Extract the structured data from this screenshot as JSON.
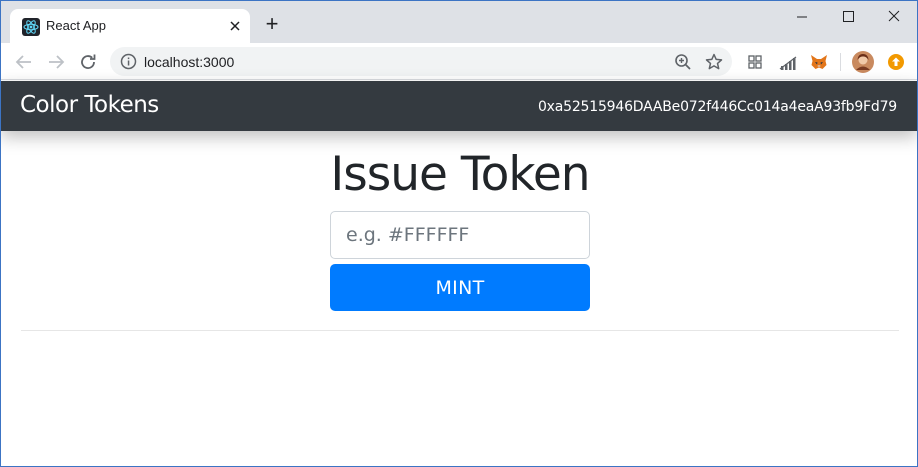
{
  "browser": {
    "tab": {
      "title": "React App",
      "favicon": "react-logo-icon"
    },
    "new_tab_label": "+",
    "omnibox": {
      "url": "localhost:3000"
    },
    "icons": {
      "back": "arrow-left-icon",
      "forward": "arrow-right-icon",
      "reload": "reload-icon",
      "info": "info-icon",
      "zoom": "zoom-icon",
      "bookmark": "star-icon",
      "extensions": [
        "grid-extension-icon",
        "signal-extension-icon",
        "metamask-fox-icon",
        "profile-avatar-icon",
        "update-badge-icon"
      ]
    }
  },
  "app": {
    "brand": "Color Tokens",
    "account": "0xa52515946DAABe072f446Cc014a4eaA93fb9Fd79",
    "heading": "Issue Token",
    "color_input": {
      "placeholder": "e.g. #FFFFFF",
      "value": ""
    },
    "mint_label": "MINT",
    "colors": {
      "navbar": "#343a40",
      "primary": "#007bff",
      "text": "#212529"
    }
  }
}
